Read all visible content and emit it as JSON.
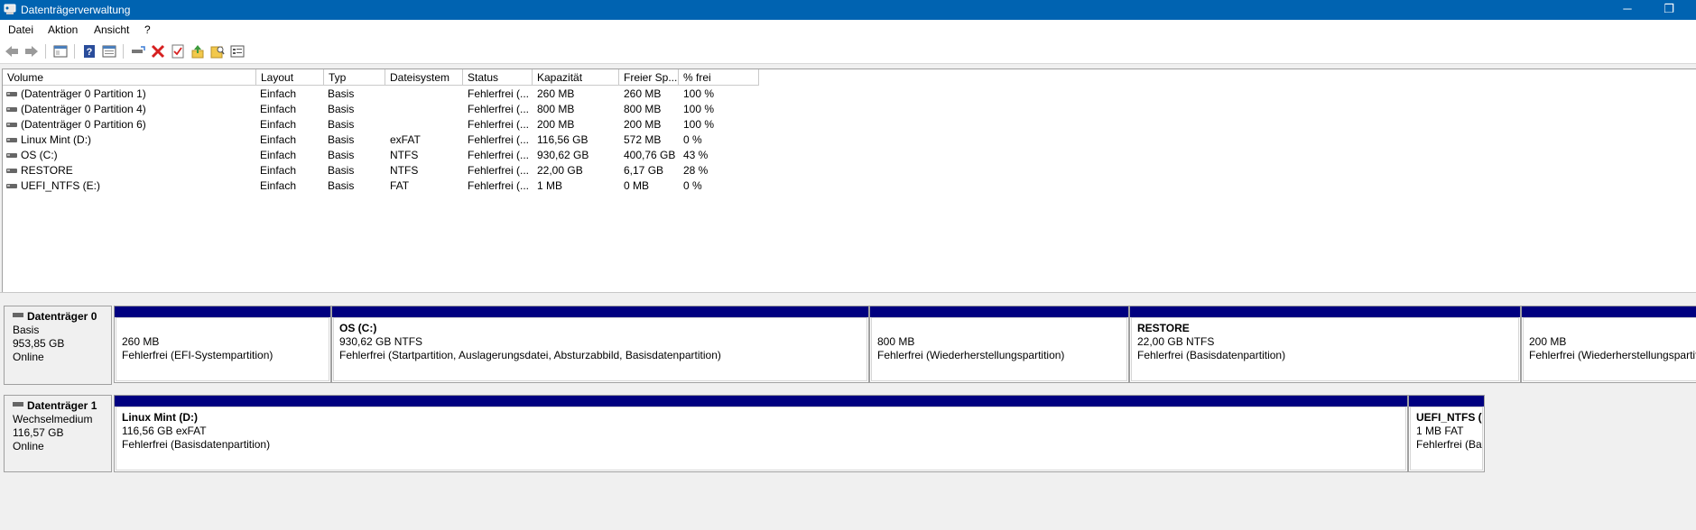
{
  "window": {
    "title": "Datenträgerverwaltung",
    "minimize_glyph": "─",
    "restore_glyph": "❐"
  },
  "menu": [
    "Datei",
    "Aktion",
    "Ansicht",
    "?"
  ],
  "toolbar": {
    "icons": [
      "back-arrow-icon",
      "forward-arrow-icon",
      "console-tree-icon",
      "properties-icon",
      "help-icon",
      "show-hide-icon",
      "connect-disk-icon",
      "delete-icon",
      "check-icon",
      "export-icon",
      "search-icon",
      "console-icon"
    ]
  },
  "volume_table": {
    "columns": [
      "Volume",
      "Layout",
      "Typ",
      "Dateisystem",
      "Status",
      "Kapazität",
      "Freier Sp...",
      "% frei"
    ],
    "rows": [
      {
        "volume": "(Datenträger 0 Partition 1)",
        "layout": "Einfach",
        "typ": "Basis",
        "fs": "",
        "status": "Fehlerfrei (...",
        "cap": "260 MB",
        "free": "260 MB",
        "pct": "100 %"
      },
      {
        "volume": "(Datenträger 0 Partition 4)",
        "layout": "Einfach",
        "typ": "Basis",
        "fs": "",
        "status": "Fehlerfrei (...",
        "cap": "800 MB",
        "free": "800 MB",
        "pct": "100 %"
      },
      {
        "volume": "(Datenträger 0 Partition 6)",
        "layout": "Einfach",
        "typ": "Basis",
        "fs": "",
        "status": "Fehlerfrei (...",
        "cap": "200 MB",
        "free": "200 MB",
        "pct": "100 %"
      },
      {
        "volume": "Linux Mint  (D:)",
        "layout": "Einfach",
        "typ": "Basis",
        "fs": "exFAT",
        "status": "Fehlerfrei (...",
        "cap": "116,56 GB",
        "free": "572 MB",
        "pct": "0 %"
      },
      {
        "volume": "OS (C:)",
        "layout": "Einfach",
        "typ": "Basis",
        "fs": "NTFS",
        "status": "Fehlerfrei (...",
        "cap": "930,62 GB",
        "free": "400,76 GB",
        "pct": "43 %"
      },
      {
        "volume": "RESTORE",
        "layout": "Einfach",
        "typ": "Basis",
        "fs": "NTFS",
        "status": "Fehlerfrei (...",
        "cap": "22,00 GB",
        "free": "6,17 GB",
        "pct": "28 %"
      },
      {
        "volume": "UEFI_NTFS (E:)",
        "layout": "Einfach",
        "typ": "Basis",
        "fs": "FAT",
        "status": "Fehlerfrei (...",
        "cap": "1 MB",
        "free": "0 MB",
        "pct": "0 %"
      }
    ]
  },
  "disks": [
    {
      "name": "Datenträger 0",
      "type": "Basis",
      "size": "953,85 GB",
      "state": "Online",
      "partitions": [
        {
          "name": "",
          "size": "260 MB",
          "status": "Fehlerfrei (EFI-Systempartition)"
        },
        {
          "name": "OS  (C:)",
          "size": "930,62 GB NTFS",
          "status": "Fehlerfrei (Startpartition, Auslagerungsdatei, Absturzabbild, Basisdatenpartition)"
        },
        {
          "name": "",
          "size": "800 MB",
          "status": "Fehlerfrei (Wiederherstellungspartition)"
        },
        {
          "name": "RESTORE",
          "size": "22,00 GB NTFS",
          "status": "Fehlerfrei (Basisdatenpartition)"
        },
        {
          "name": "",
          "size": "200 MB",
          "status": "Fehlerfrei (Wiederherstellungspartition)"
        }
      ]
    },
    {
      "name": "Datenträger 1",
      "type": "Wechselmedium",
      "size": "116,57 GB",
      "state": "Online",
      "partitions": [
        {
          "name": "Linux Mint   (D:)",
          "size": "116,56 GB exFAT",
          "status": "Fehlerfrei (Basisdatenpartition)"
        },
        {
          "name": "UEFI_NTFS  (",
          "size": "1 MB FAT",
          "status": "Fehlerfrei (Ba"
        }
      ]
    }
  ]
}
